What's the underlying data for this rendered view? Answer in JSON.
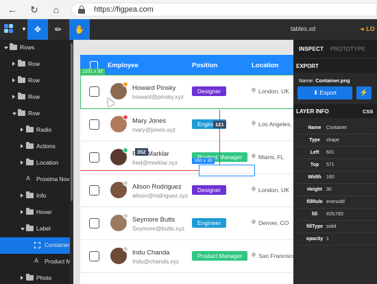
{
  "browser": {
    "url": "https://figpea.com",
    "back_icon": "arrow-left-icon",
    "refresh_icon": "refresh-icon",
    "home_icon": "home-icon"
  },
  "toolbar": {
    "file_name": "tables.xd",
    "login_label": "LO",
    "accent": "#1677e6"
  },
  "layers": [
    {
      "label": "Rows",
      "depth": 0,
      "arrow": "down",
      "icon": "folder"
    },
    {
      "label": "Row",
      "depth": 1,
      "arrow": "right",
      "icon": "folder"
    },
    {
      "label": "Row",
      "depth": 1,
      "arrow": "right",
      "icon": "folder"
    },
    {
      "label": "Row",
      "depth": 1,
      "arrow": "right",
      "icon": "folder"
    },
    {
      "label": "Row",
      "depth": 1,
      "arrow": "down",
      "icon": "folder"
    },
    {
      "label": "Radio",
      "depth": 2,
      "arrow": "right",
      "icon": "folder"
    },
    {
      "label": "Actions",
      "depth": 2,
      "arrow": "right",
      "icon": "folder"
    },
    {
      "label": "Location",
      "depth": 2,
      "arrow": "right",
      "icon": "folder"
    },
    {
      "label": "Proxima Nova",
      "depth": 2,
      "arrow": "none",
      "icon": "text"
    },
    {
      "label": "Info",
      "depth": 2,
      "arrow": "right",
      "icon": "folder"
    },
    {
      "label": "Hover",
      "depth": 2,
      "arrow": "right",
      "icon": "folder"
    },
    {
      "label": "Label",
      "depth": 2,
      "arrow": "down",
      "icon": "folder"
    },
    {
      "label": "Container",
      "depth": 3,
      "arrow": "none",
      "icon": "rect",
      "selected": true
    },
    {
      "label": "Product Manager",
      "depth": 3,
      "arrow": "none",
      "icon": "text"
    },
    {
      "label": "Photo",
      "depth": 2,
      "arrow": "right",
      "icon": "folder"
    }
  ],
  "table": {
    "headers": {
      "employee": "Employee",
      "position": "Position",
      "location": "Location"
    },
    "rows": [
      {
        "name": "Howard Pinsky",
        "email": "howard@pinsky.xyz",
        "position": "Designer",
        "badge_color": "#6e32d6",
        "location": "London, UK",
        "avatar_color": "#8a6b52",
        "status_color": "#f5a623"
      },
      {
        "name": "Mary Jones",
        "email": "mary@jones.xyz",
        "position": "Engineer",
        "badge_color": "#1e9ad6",
        "location": "Los Angeles, CA",
        "avatar_color": "#b07a5c",
        "status_color": "#e84c5a"
      },
      {
        "name": "Fred Marklar",
        "email": "fred@marklar.xyz",
        "position": "Product Manager",
        "badge_color": "#2fc783",
        "location": "Miami, FL",
        "avatar_color": "#5a3a2c",
        "status_color": "#2fc783"
      },
      {
        "name": "Alison Rodriguez",
        "email": "alison@rodriguez.xyz",
        "position": "Designer",
        "badge_color": "#6e32d6",
        "location": "London, UK",
        "avatar_color": "#7a5540",
        "status_color": "#cfcfcf"
      },
      {
        "name": "Seymore Butts",
        "email": "Seymore@butts.xyz",
        "position": "Engineer",
        "badge_color": "#1e9ad6",
        "location": "Denver, CO",
        "avatar_color": "#9c7a62",
        "status_color": "#cfcfcf"
      },
      {
        "name": "Indu Chanda",
        "email": "Indu@chanda.xyz",
        "position": "Product Manager",
        "badge_color": "#2fc783",
        "location": "San Francisco, CA",
        "avatar_color": "#6b4a38",
        "status_color": "#cfcfcf"
      }
    ]
  },
  "overlays": {
    "row_size": "1101 x 92",
    "container_size": "160 x 30",
    "dist_top": "121",
    "dist_left": "352"
  },
  "inspect": {
    "tab_inspect": "INSPECT",
    "tab_prototype": "PROTOTYPE",
    "export_title": "EXPORT",
    "export_name_label": "Name:",
    "export_name": "Container.png",
    "export_button": "Export",
    "layer_info_title": "LAYER INFO",
    "css_label": "CSS",
    "props": [
      {
        "key": "Name",
        "value": "Container"
      },
      {
        "key": "Type",
        "value": "shape"
      },
      {
        "key": "Left",
        "value": "601"
      },
      {
        "key": "Top",
        "value": "571"
      },
      {
        "key": "Width",
        "value": "160"
      },
      {
        "key": "Height",
        "value": "30"
      },
      {
        "key": "fillRule",
        "value": "evenodd"
      },
      {
        "key": "fill",
        "value": "#2fc783"
      },
      {
        "key": "fillType",
        "value": "solid"
      },
      {
        "key": "opacity",
        "value": "1"
      }
    ]
  }
}
